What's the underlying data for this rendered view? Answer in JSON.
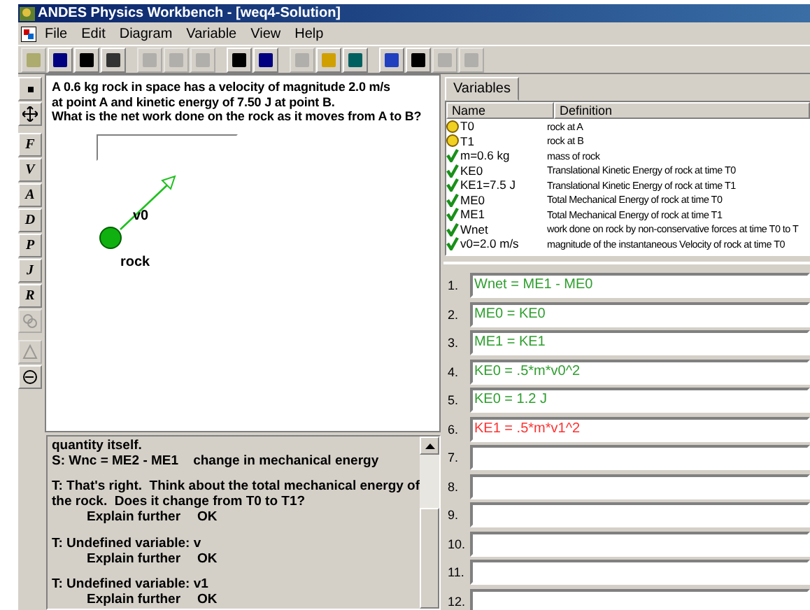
{
  "window": {
    "title": "ANDES Physics Workbench - [weq4-Solution]"
  },
  "menu": [
    "File",
    "Edit",
    "Diagram",
    "Variable",
    "View",
    "Help"
  ],
  "tools": [
    "F",
    "V",
    "A",
    "D",
    "P",
    "J",
    "R"
  ],
  "problem": {
    "statement": [
      "A 0.6 kg rock in space has a velocity of magnitude 2.0 m/s",
      "at point A and kinetic energy of 7.50 J at point B.",
      "What is the net work done on the rock as it moves from A to B?"
    ]
  },
  "diagram": {
    "body_label": "rock",
    "vector_label": "v0"
  },
  "variables": {
    "tab": "Variables",
    "columns": [
      "Name",
      "Definition"
    ],
    "rows": [
      {
        "kind": "body",
        "name": "T0",
        "definition": "rock at A"
      },
      {
        "kind": "body",
        "name": "T1",
        "definition": "rock at B"
      },
      {
        "kind": "checked",
        "name": "m=0.6 kg",
        "definition": "mass of rock"
      },
      {
        "kind": "checked",
        "name": "KE0",
        "definition": "Translational Kinetic Energy of rock at time T0"
      },
      {
        "kind": "checked",
        "name": "KE1=7.5 J",
        "definition": "Translational Kinetic Energy of rock at time T1"
      },
      {
        "kind": "checked",
        "name": "ME0",
        "definition": "Total Mechanical Energy of rock at time T0"
      },
      {
        "kind": "checked",
        "name": "ME1",
        "definition": "Total Mechanical Energy of rock at time T1"
      },
      {
        "kind": "checked",
        "name": "Wnet",
        "definition": "work done on rock by non-conservative forces at time T0 to T"
      },
      {
        "kind": "checked",
        "name": "v0=2.0 m/s",
        "definition": "magnitude of the instantaneous Velocity of rock at time T0"
      }
    ]
  },
  "equations": [
    {
      "number": "1.",
      "text": "Wnet = ME1 - ME0",
      "correct": true
    },
    {
      "number": "2.",
      "text": "ME0 = KE0",
      "correct": true
    },
    {
      "number": "3.",
      "text": "ME1 = KE1",
      "correct": true
    },
    {
      "number": "4.",
      "text": "KE0 = .5*m*v0^2",
      "correct": true
    },
    {
      "number": "5.",
      "text": "KE0 = 1.2 J",
      "correct": true
    },
    {
      "number": "6.",
      "text": "KE1 = .5*m*v1^2",
      "correct": false
    },
    {
      "number": "7."
    },
    {
      "number": "8."
    },
    {
      "number": "9."
    },
    {
      "number": "10."
    },
    {
      "number": "11."
    },
    {
      "number": "12."
    }
  ],
  "feedback": [
    {
      "kind": "text",
      "text": "quantity itself."
    },
    {
      "kind": "text",
      "text": "S: Wnc = ME2 - ME1    change in mechanical energy"
    },
    {
      "kind": "blank"
    },
    {
      "kind": "text",
      "text": "T: That's right.  Think about the total mechanical energy of"
    },
    {
      "kind": "text",
      "text": "the rock.  Does it change from T0 to T1?"
    },
    {
      "kind": "links",
      "links": [
        "Explain further",
        "OK"
      ]
    },
    {
      "kind": "blank"
    },
    {
      "kind": "text",
      "text": "T: Undefined variable: v"
    },
    {
      "kind": "links",
      "links": [
        "Explain further",
        "OK"
      ]
    },
    {
      "kind": "blank"
    },
    {
      "kind": "text",
      "text": "T: Undefined variable: v1"
    },
    {
      "kind": "links",
      "links": [
        "Explain further",
        "OK"
      ]
    }
  ]
}
